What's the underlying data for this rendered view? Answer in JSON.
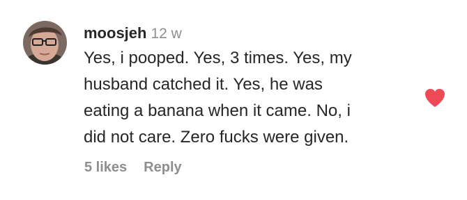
{
  "comment": {
    "username": "moosjeh",
    "timestamp": "12 w",
    "text_lines": [
      "Yes, i pooped. Yes, 3 times. Yes, my",
      "husband catched it. Yes, he was",
      "eating a banana when it came. No, i",
      "did not care. Zero fucks were given."
    ],
    "likes_label": "5 likes",
    "reply_label": "Reply",
    "liked": true
  },
  "colors": {
    "text": "#262626",
    "secondary": "#8e8e8e",
    "heart": "#ed4956"
  },
  "icons": {
    "like": "heart-icon",
    "avatar": "user-avatar"
  }
}
